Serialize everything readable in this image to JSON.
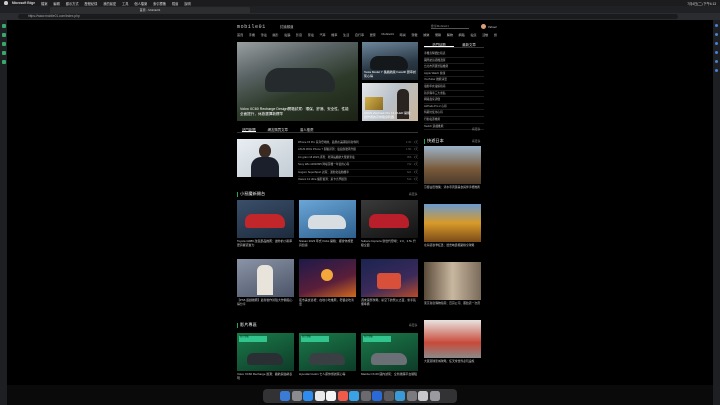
{
  "menubar": {
    "app": "Microsoft Edge",
    "menus": [
      "檔案",
      "編輯",
      "顯示方式",
      "歷程紀錄",
      "我的最愛",
      "工具",
      "個人檔案",
      "索引標籤",
      "視窗",
      "說明"
    ],
    "clock": "7月4日(二) 下午4:13"
  },
  "browser": {
    "tab_title": "首頁 - Mobile01",
    "url": "https://www.mobile01.com/index.php"
  },
  "site": {
    "logo": "mobile01",
    "category_select": "討論頻道",
    "search_placeholder": "搜尋Mobile01",
    "username": "Yahoo!",
    "nav": [
      "首頁",
      "手機",
      "筆電",
      "攝影",
      "電腦",
      "影音",
      "家電",
      "汽車",
      "機車",
      "生活",
      "自行車",
      "居家",
      "Mobile01",
      "時尚",
      "穿戴",
      "娛樂",
      "閒聊",
      "購物",
      "網路",
      "電競",
      "活動",
      "旅遊",
      "更多"
    ],
    "hero_main_title": "Volvo XC60 Recharge Design開箱試駕：環保、舒適、安全性、性能全面提升，休旅選擇新標竿",
    "hero_side": [
      {
        "title": "Tesla Model Y 長續航版 Facelift 實車試駕心得"
      },
      {
        "title": "ASUS Zenbook Pro 14 OLED 開箱：創作者的高效隨身利器"
      }
    ],
    "right_tabs": [
      "熱門話題",
      "最新文章"
    ],
    "right_list": [
      "手機直購價比較表",
      "國際航班搭機選擇",
      "台北市周邊景點推薦",
      "Apple Watch 健康",
      "YouTuber 推薦清單",
      "電動車充電樁指南",
      "新手購車三大重點",
      "網路賣家評價",
      "AirPods Pro 2 心得",
      "特斯拉使用心得",
      "行動電源推薦",
      "Switch 遊戲推薦"
    ],
    "right_more": "看更多",
    "main_tabs": [
      "熱門新聞",
      "網友購買文章",
      "達人推薦"
    ],
    "news": [
      {
        "t": "iPhone 15 Pro 系列登場前，蘋果在美國取得新專利",
        "m": "2.3K · 1天"
      },
      {
        "t": "ASUS ROG Phone 7 開箱評測：電競旗艦再升級",
        "m": "1.8K · 1天"
      },
      {
        "t": "LG gram 16 2023 評測：輕薄長續航大螢幕筆電",
        "m": "956 · 2天"
      },
      {
        "t": "Sony WH-1000XM5 降噪耳機一年使用心得",
        "m": "742 · 2天"
      },
      {
        "t": "Gogoro SuperSport 試駕：運動化電動機車",
        "m": "621 · 3天"
      },
      {
        "t": "Xiaomi 13 Ultra 攝影實測：萊卡光學鏡頭",
        "m": "513 · 3天"
      }
    ],
    "section_small": "小惡魔新開台",
    "section_small_more": "看更多",
    "cards": [
      {
        "cap": "Toyota GR86 改裝部品推薦：讓你的小跑車更具賽道實力"
      },
      {
        "cap": "Nissan 2023 年式 Kicks 開箱：都會休旅更具質感"
      },
      {
        "cap": "Subaru Impreza 新世代登場：2.0、2.5L 升級全面"
      },
      {
        "cap": "【PS5 遊戲推薦】最新動作冒險大作體驗心得分享"
      },
      {
        "cap": "夜市美食巡禮：在地小吃推薦，老饕必吃清單"
      },
      {
        "cap": "週末露營攻略：星空下的營火之夜，新手裝備準備"
      }
    ],
    "section_video": "影片專區",
    "section_video_more": "看更多",
    "videos": [
      {
        "badge": "影片開箱",
        "cap": "Volvo XC60 Recharge 實測：續航與油耗表現"
      },
      {
        "badge": "影片開箱",
        "cap": "Hyundai Custin 七人座休旅試駕心得"
      },
      {
        "badge": "影片開箱",
        "cap": "Mazda CX-60 國內試駕：全新後驅平台體驗"
      }
    ],
    "japan_title": "快遊日本",
    "japan_more": "看更多",
    "japan": [
      {
        "cap": "京都古街散策：清水寺周邊美食與伴手禮推薦"
      },
      {
        "cap": "北海道秋季紅葉：層雲峽賞楓路線全攻略"
      },
      {
        "cap": "東京新宿購物指南：百貨公司、藥妝店一次逛"
      },
      {
        "cap": "大阪環球影城攻略：任天堂世界必玩設施"
      }
    ]
  }
}
